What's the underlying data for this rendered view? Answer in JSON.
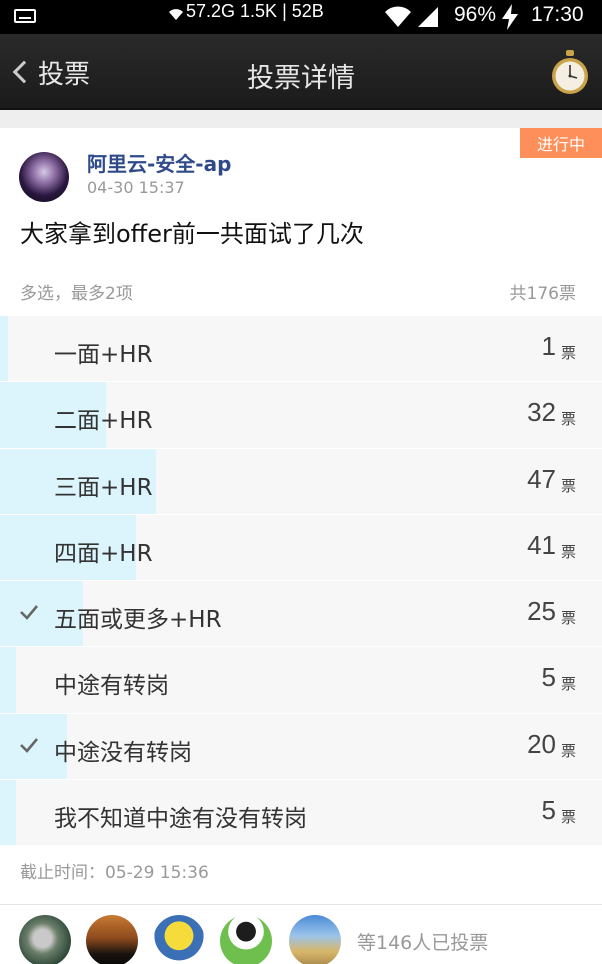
{
  "status_bar": {
    "net_stats": "57.2G 1.5K | 52B",
    "battery": "96%",
    "time": "17:30",
    "icons": [
      "keyboard-icon",
      "wifi-icon",
      "signal-icon",
      "charging-icon"
    ]
  },
  "nav": {
    "back_label": "投票",
    "title": "投票详情",
    "right_icon": "stopwatch-icon"
  },
  "poll": {
    "status_badge": "进行中",
    "author": "阿里云-安全-ap",
    "post_time": "04-30 15:37",
    "question": "大家拿到offer前一共面试了几次",
    "rule": "多选，最多2项",
    "total_votes": "共176票",
    "options": [
      {
        "label": "一面+HR",
        "count": "1",
        "unit": "票",
        "share": 0.006,
        "checked": false
      },
      {
        "label": "二面+HR",
        "count": "32",
        "unit": "票",
        "share": 0.182,
        "checked": false
      },
      {
        "label": "三面+HR",
        "count": "47",
        "unit": "票",
        "share": 0.267,
        "checked": false
      },
      {
        "label": "四面+HR",
        "count": "41",
        "unit": "票",
        "share": 0.233,
        "checked": false
      },
      {
        "label": "五面或更多+HR",
        "count": "25",
        "unit": "票",
        "share": 0.142,
        "checked": true
      },
      {
        "label": "中途有转岗",
        "count": "5",
        "unit": "票",
        "share": 0.028,
        "checked": false
      },
      {
        "label": "中途没有转岗",
        "count": "20",
        "unit": "票",
        "share": 0.114,
        "checked": true
      },
      {
        "label": "我不知道中途有没有转岗",
        "count": "5",
        "unit": "票",
        "share": 0.028,
        "checked": false
      }
    ],
    "deadline": "截止时间：05-29 15:36",
    "voters_text": "等146人已投票"
  },
  "colors": {
    "badge": "#ff8f5a",
    "author": "#2e4a8a",
    "bar_fill": "#dcf5fc",
    "row_bg": "#f7f7f7"
  }
}
